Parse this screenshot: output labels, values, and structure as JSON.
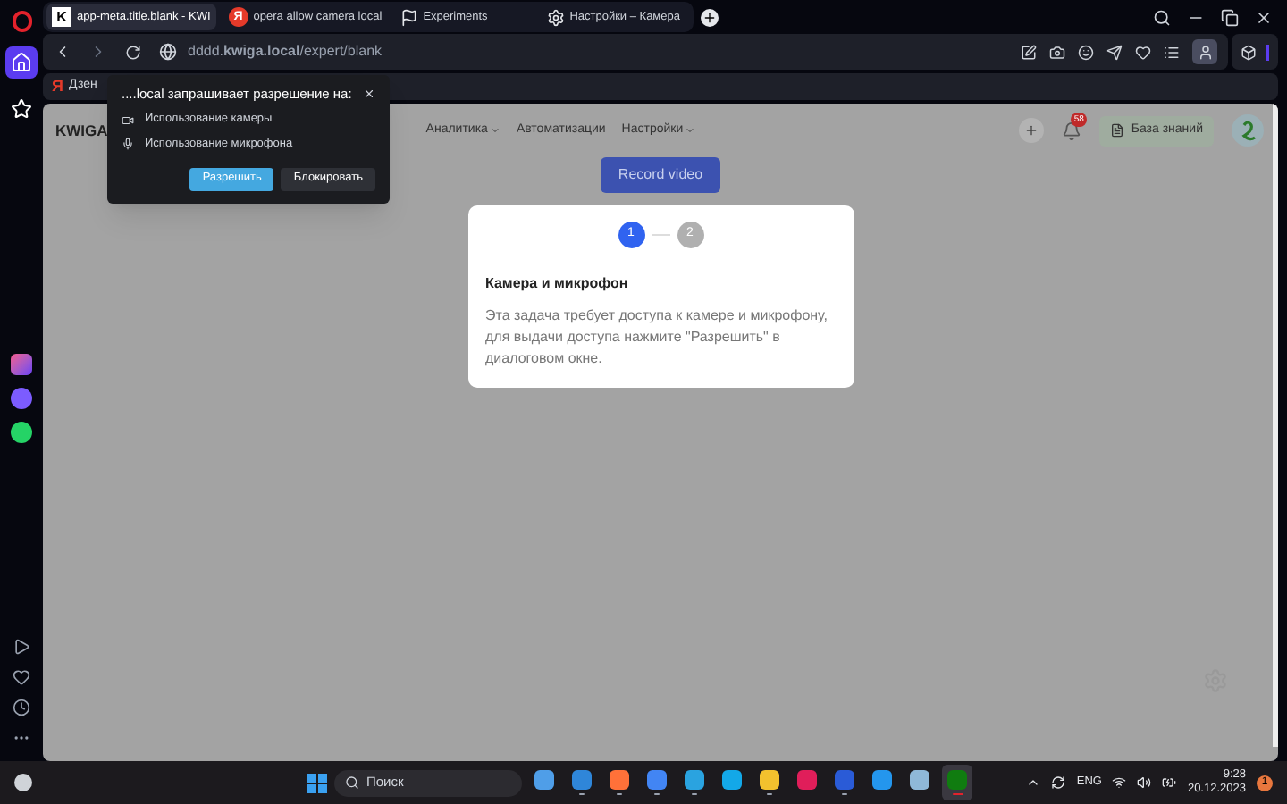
{
  "tabs": [
    {
      "title": "app-meta.title.blank - KWI",
      "selected": true,
      "kind": "letter",
      "icon_text": "K"
    },
    {
      "title": "opera allow camera local",
      "selected": false,
      "kind": "yandex",
      "icon_text": "Я"
    },
    {
      "title": "Experiments",
      "selected": false,
      "kind": "flag"
    },
    {
      "title": "Настройки – Камера",
      "selected": false,
      "kind": "gear"
    }
  ],
  "address_bar": {
    "url": "dddd.**kwiga.local**/expert/blank"
  },
  "bookmarks": [
    {
      "label": "Дзен",
      "icon_text": "Я"
    }
  ],
  "sidebar": {
    "items": [
      {
        "kind": "home",
        "selected": true
      },
      {
        "kind": "star",
        "selected": false
      }
    ]
  },
  "page": {
    "logo": "KWIGA",
    "nav": [
      {
        "label": "Аналитика",
        "dropdown": true
      },
      {
        "label": "Автоматизации",
        "dropdown": false
      },
      {
        "label": "Настройки",
        "dropdown": true
      }
    ],
    "notifications_badge": "58",
    "knowledge_base": "База знаний",
    "record_button": "Record video",
    "card": {
      "steps": [
        {
          "label": "1",
          "selected": true
        },
        {
          "label": "2",
          "selected": false
        }
      ],
      "title": "Камера и микрофон",
      "text": "Эта задача требует доступа к камере и микрофону, для выдачи доступа нажмите \"Разрешить\" в диалоговом окне."
    }
  },
  "permission_popup": {
    "title": "....local запрашивает разрешение на:",
    "items": [
      {
        "kind": "camera",
        "label": "Использование камеры"
      },
      {
        "kind": "mic",
        "label": "Использование микрофона"
      }
    ],
    "allow": "Разрешить",
    "block": "Блокировать"
  },
  "taskbar": {
    "search_placeholder": "Поиск",
    "apps": [
      {
        "running": false,
        "selected": false
      },
      {
        "running": true,
        "selected": false
      },
      {
        "running": true,
        "selected": false
      },
      {
        "running": true,
        "selected": false
      },
      {
        "running": true,
        "selected": false
      },
      {
        "running": false,
        "selected": false
      },
      {
        "running": true,
        "selected": false
      },
      {
        "running": false,
        "selected": false
      },
      {
        "running": true,
        "selected": false
      },
      {
        "running": false,
        "selected": false
      },
      {
        "running": false,
        "selected": false
      },
      {
        "running": true,
        "selected": true
      }
    ],
    "language": "ENG",
    "time": "9:28",
    "date": "20.12.2023",
    "notification_count": "1"
  }
}
